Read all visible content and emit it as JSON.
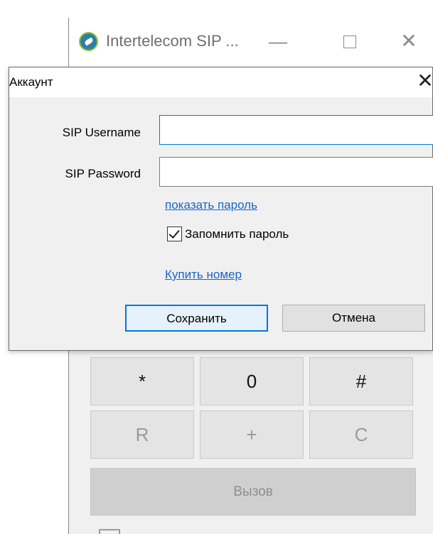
{
  "main_window": {
    "title": "Intertelecom SIP ...",
    "controls": {
      "minimize": "—",
      "close": "✕"
    },
    "keypad": [
      {
        "label": "*",
        "dim": false
      },
      {
        "label": "0",
        "dim": false
      },
      {
        "label": "#",
        "dim": false
      },
      {
        "label": "R",
        "dim": true
      },
      {
        "label": "+",
        "dim": true
      },
      {
        "label": "C",
        "dim": true
      }
    ],
    "call_button": "Вызов"
  },
  "dialog": {
    "title": "Аккаунт",
    "close": "✕",
    "username_label": "SIP Username",
    "username_value": "",
    "password_label": "SIP Password",
    "password_value": "",
    "show_password_link": "показать пароль",
    "remember_password": {
      "label": "Запомнить пароль",
      "checked": true
    },
    "buy_number_link": "Купить номер",
    "save_button": "Сохранить",
    "cancel_button": "Отмена"
  },
  "colors": {
    "accent": "#0078d7",
    "link": "#1a64c8",
    "window_bg": "#f0f0f0"
  }
}
